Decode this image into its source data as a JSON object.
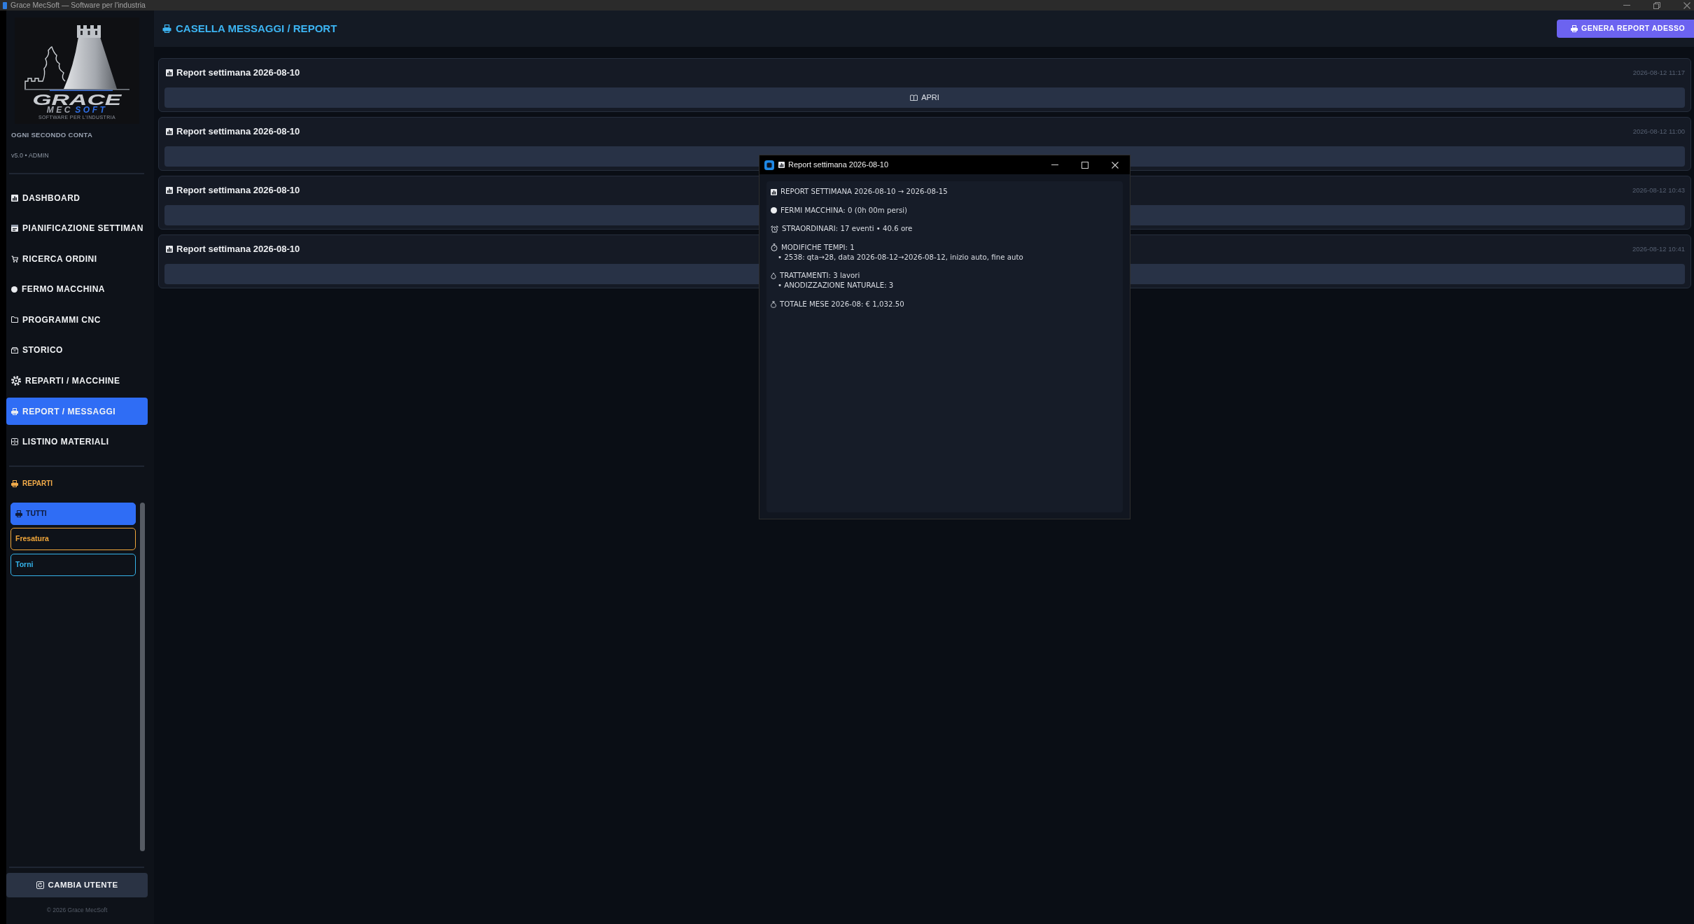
{
  "window": {
    "title": "Grace MecSoft — Software per l'industria"
  },
  "sidebar": {
    "logo": {
      "title": "GRACE",
      "subtitle_parts": [
        {
          "text": "MEC",
          "accent": false
        },
        {
          "text": "SOFT",
          "accent": true
        }
      ],
      "tagline": "SOFTWARE PER L'INDUSTRIA"
    },
    "slogan": "OGNI SECONDO CONTA",
    "version": "v5.0 • ADMIN",
    "items": [
      {
        "label": "DASHBOARD",
        "selected": false
      },
      {
        "label": "PIANIFICAZIONE SETTIMAN",
        "selected": false
      },
      {
        "label": "RICERCA ORDINI",
        "selected": false
      },
      {
        "label": "FERMO MACCHINA",
        "selected": false
      },
      {
        "label": "PROGRAMMI CNC",
        "selected": false
      },
      {
        "label": "STORICO",
        "selected": false
      },
      {
        "label": "REPARTI / MACCHINE",
        "selected": false
      },
      {
        "label": "REPORT / MESSAGGI",
        "selected": true
      },
      {
        "label": "LISTINO MATERIALI",
        "selected": false
      }
    ],
    "reparti": {
      "title": "REPARTI",
      "items": [
        {
          "kind": "all",
          "label": "TUTTI",
          "selected": true
        },
        {
          "kind": "department",
          "label": "Fresatura",
          "selected": false,
          "color": "#f0a63a"
        },
        {
          "kind": "department",
          "label": "Torni",
          "selected": false,
          "color": "#35b3ea"
        }
      ]
    },
    "user_button": "CAMBIA UTENTE",
    "copyright": "© 2026 Grace MecSoft"
  },
  "header": {
    "title": "CASELLA MESSAGGI / REPORT",
    "action": "GENERA REPORT ADESSO"
  },
  "reports": [
    {
      "title": "Report settimana 2026-08-10",
      "time": "2026-08-12 11:17",
      "button": "APRI"
    },
    {
      "title": "Report settimana 2026-08-10",
      "time": "2026-08-12 11:00"
    },
    {
      "title": "Report settimana 2026-08-10",
      "time": "2026-08-12 10:43"
    },
    {
      "title": "Report settimana 2026-08-10",
      "time": "2026-08-12 10:41"
    }
  ],
  "dialog": {
    "title": "Report settimana 2026-08-10",
    "sections": [
      {
        "heading": "REPORT SETTIMANA 2026-08-10 → 2026-08-15"
      },
      {
        "heading": "FERMI MACCHINA: 0 (0h 00m persi)"
      },
      {
        "heading": "STRAORDINARI: 17 eventi • 40.6 ore"
      },
      {
        "heading": "MODIFICHE TEMPI: 1",
        "details": [
          "• 2538: qta→28, data 2026-08-12→2026-08-12, inizio auto, fine auto"
        ]
      },
      {
        "heading": "TRATTAMENTI: 3 lavori",
        "details": [
          "• ANODIZZAZIONE NATURALE: 3"
        ]
      },
      {
        "heading": "TOTALE MESE 2026-08: € 1,032.50"
      }
    ]
  }
}
